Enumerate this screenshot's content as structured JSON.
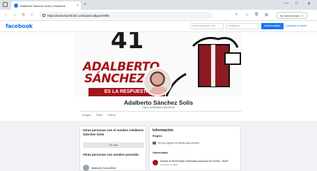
{
  "browser": {
    "tab_title": "Adalberto Sánchez Solís | Facebook",
    "url": "https://www.facebook.com/juancodigues/980",
    "profile_label": "No sincronizado"
  },
  "facebook": {
    "logo": "facebook",
    "email_placeholder": "Correo electrónico o tel",
    "password_placeholder": "Contraseña",
    "login_label": "Iniciar sesión",
    "forgot_label": "¿Olvidaste la cuenta?"
  },
  "cover": {
    "number": "41",
    "name_line1": "ADALBERTO",
    "name_line2": "SÁNCHEZ",
    "slogan": "ES LA RESPUESTA"
  },
  "profile": {
    "name": "Adalberto Sánchez Solís",
    "category": "Liga y actividades deportivas",
    "tabs": [
      "Amigos",
      "Fotos",
      "Videos"
    ]
  },
  "left_card": {
    "title": "Otras personas con el nombre Adalberto Sánchez Solís",
    "see_more": "Ver más",
    "similar_title": "Otras personas con nombre parecido",
    "person": "Adalberto Sousa Brito"
  },
  "info": {
    "title": "Información",
    "employment_heading": "Empleo",
    "employment_value": "No hay lugares de trabajo para mostrar",
    "university_heading": "Universidad",
    "university_name": "Estudió en Benemérita Universidad Autónoma de Puebla - BUAP",
    "university_sub": "Comenzó en 1998"
  }
}
